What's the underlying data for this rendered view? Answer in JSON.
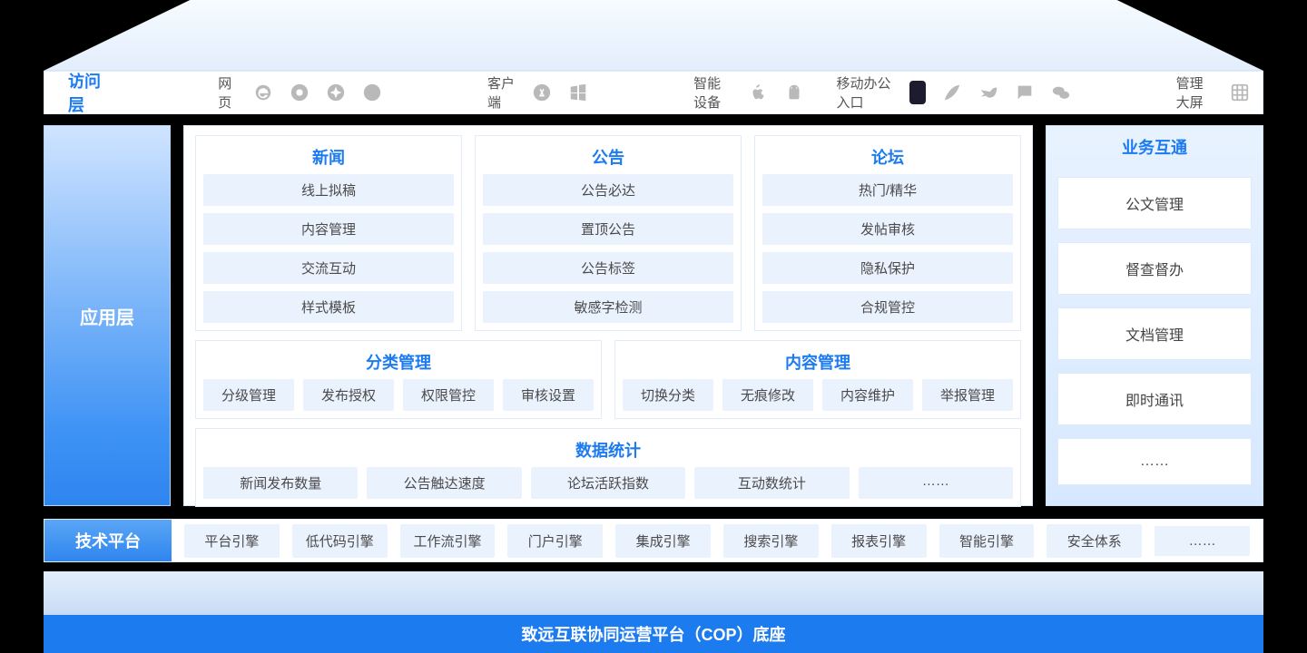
{
  "access": {
    "title": "访问层",
    "groups": {
      "web": "网页",
      "client": "客户端",
      "smart": "智能设备",
      "mobile": "移动办公入口",
      "dashboard": "管理大屏"
    }
  },
  "app_layer_label": "应用层",
  "top_groups": [
    {
      "title": "新闻",
      "items": [
        "线上拟稿",
        "内容管理",
        "交流互动",
        "样式模板"
      ]
    },
    {
      "title": "公告",
      "items": [
        "公告必达",
        "置顶公告",
        "公告标签",
        "敏感字检测"
      ]
    },
    {
      "title": "论坛",
      "items": [
        "热门/精华",
        "发帖审核",
        "隐私保护",
        "合规管控"
      ]
    }
  ],
  "mid_groups": [
    {
      "title": "分类管理",
      "items": [
        "分级管理",
        "发布授权",
        "权限管控",
        "审核设置"
      ]
    },
    {
      "title": "内容管理",
      "items": [
        "切换分类",
        "无痕修改",
        "内容维护",
        "举报管理"
      ]
    }
  ],
  "stats": {
    "title": "数据统计",
    "items": [
      "新闻发布数量",
      "公告触达速度",
      "论坛活跃指数",
      "互动数统计",
      "……"
    ]
  },
  "right": {
    "title": "业务互通",
    "items": [
      "公文管理",
      "督查督办",
      "文档管理",
      "即时通讯",
      "……"
    ]
  },
  "tech": {
    "title": "技术平台",
    "items": [
      "平台引擎",
      "低代码引擎",
      "工作流引擎",
      "门户引擎",
      "集成引擎",
      "搜索引擎",
      "报表引擎",
      "智能引擎",
      "安全体系",
      "……"
    ]
  },
  "footer": "致远互联协同运营平台（COP）底座"
}
